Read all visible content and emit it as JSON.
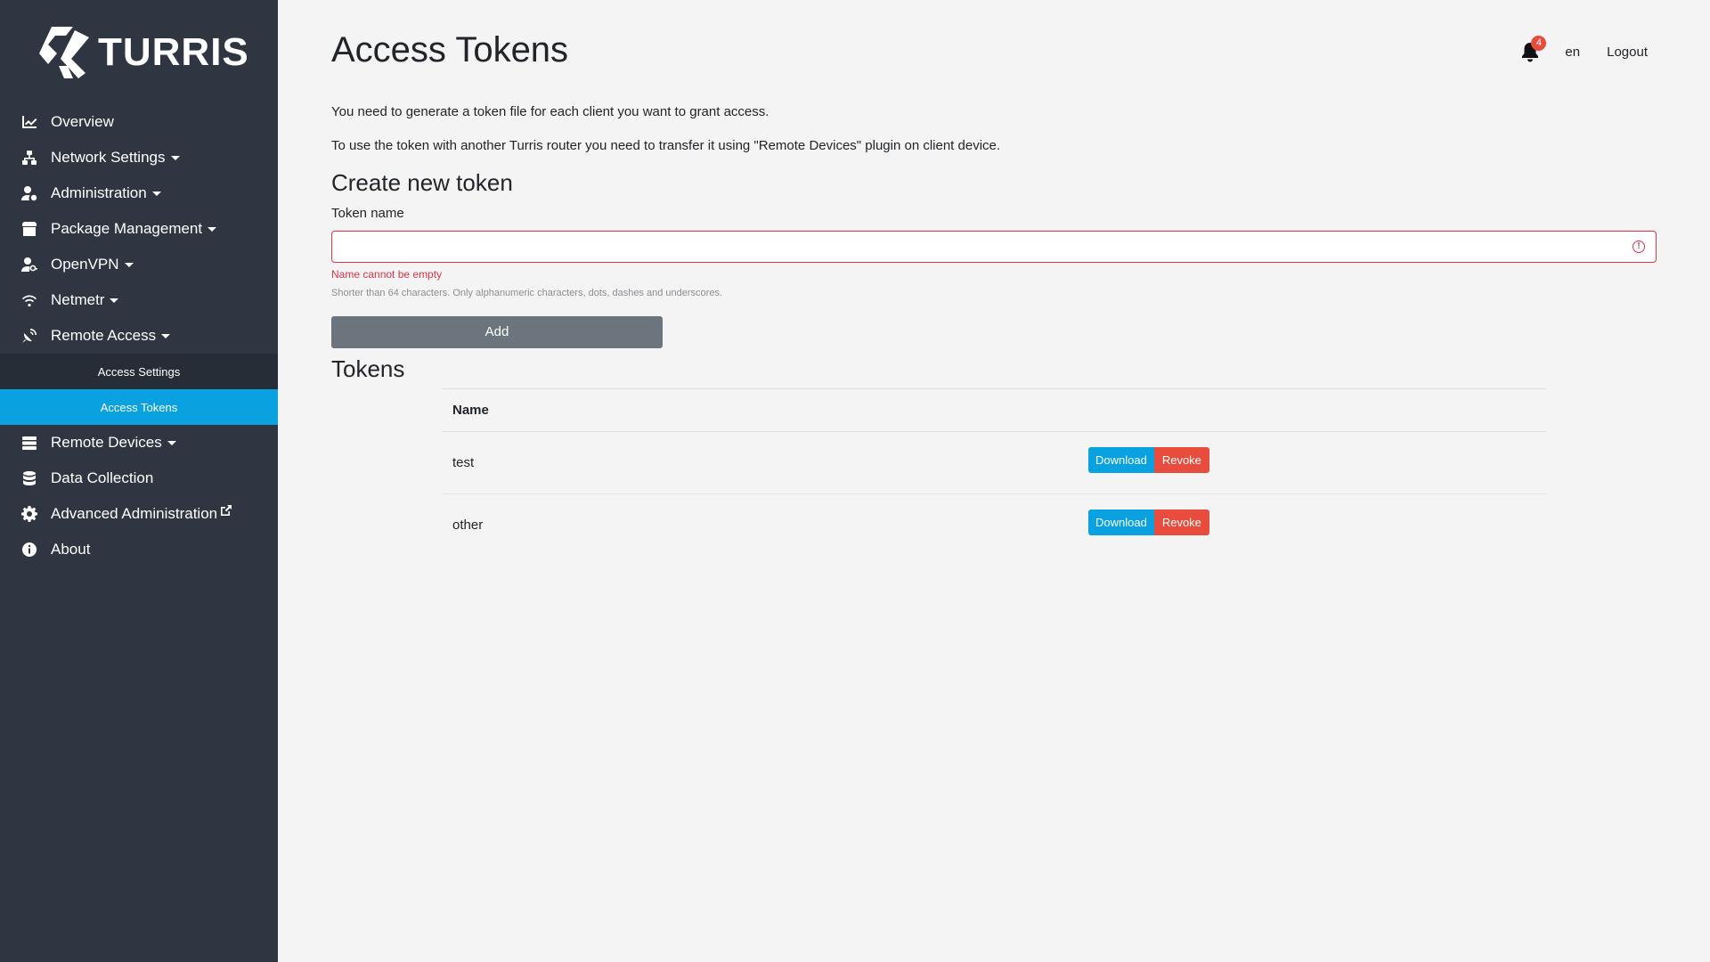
{
  "brand": {
    "name": "TURRIS"
  },
  "sidebar": {
    "items": [
      {
        "label": "Overview",
        "icon": "chart-line-icon",
        "has_caret": false
      },
      {
        "label": "Network Settings",
        "icon": "network-icon",
        "has_caret": true
      },
      {
        "label": "Administration",
        "icon": "user-cog-icon",
        "has_caret": true
      },
      {
        "label": "Package Management",
        "icon": "box-icon",
        "has_caret": true
      },
      {
        "label": "OpenVPN",
        "icon": "user-key-icon",
        "has_caret": true
      },
      {
        "label": "Netmetr",
        "icon": "wifi-icon",
        "has_caret": true
      },
      {
        "label": "Remote Access",
        "icon": "satellite-dish-icon",
        "has_caret": true
      }
    ],
    "remote_access_sub": [
      {
        "label": "Access Settings",
        "active": false
      },
      {
        "label": "Access Tokens",
        "active": true
      }
    ],
    "items_after": [
      {
        "label": "Remote Devices",
        "icon": "server-icon",
        "has_caret": true
      },
      {
        "label": "Data Collection",
        "icon": "database-icon",
        "has_caret": false
      },
      {
        "label": "Advanced Administration",
        "icon": "gear-icon",
        "has_caret": false,
        "external": true
      },
      {
        "label": "About",
        "icon": "info-icon",
        "has_caret": false
      }
    ]
  },
  "topbar": {
    "notifications_count": "4",
    "language": "en",
    "logout": "Logout"
  },
  "main": {
    "title": "Access Tokens",
    "description_1": "You need to generate a token file for each client you want to grant access.",
    "description_2": "To use the token with another Turris router you need to transfer it using \"Remote Devices\" plugin on client device.",
    "create_title": "Create new token",
    "token_name_label": "Token name",
    "token_name_value": "",
    "token_name_error": "Name cannot be empty",
    "token_name_help": "Shorter than 64 characters. Only alphanumeric characters, dots, dashes and underscores.",
    "add_button": "Add",
    "tokens_title": "Tokens",
    "table": {
      "header_name": "Name",
      "rows": [
        {
          "name": "test",
          "download": "Download",
          "revoke": "Revoke"
        },
        {
          "name": "other",
          "download": "Download",
          "revoke": "Revoke"
        }
      ]
    }
  },
  "colors": {
    "sidebar_bg": "#2f3641",
    "active_item": "#0aa1e0",
    "danger": "#e74c3c",
    "add_button": "#6c757d"
  }
}
